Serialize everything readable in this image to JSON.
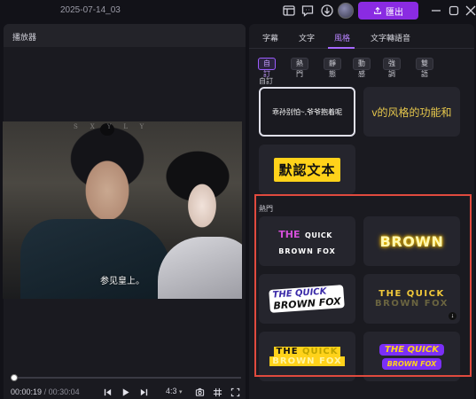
{
  "titlebar": {
    "project_name": "2025-07-14_03",
    "export_label": "匯出"
  },
  "player": {
    "header": "播放器",
    "watermark": "SXYLY",
    "subtitle": "参见皇上。",
    "current_time": "00:00:19",
    "total_time": "/ 00:30:04",
    "aspect_ratio": "4:3",
    "progress_fraction": 0.011
  },
  "sidebar": {
    "tabs": [
      {
        "label": "字幕"
      },
      {
        "label": "文字"
      },
      {
        "label": "風格",
        "active": true
      },
      {
        "label": "文字轉語音"
      }
    ],
    "filters": [
      {
        "label": "自訂",
        "active": true
      },
      {
        "label": "熱門"
      },
      {
        "label": "靜態"
      },
      {
        "label": "動感"
      },
      {
        "label": "強調"
      },
      {
        "label": "雙語"
      }
    ],
    "custom_section": {
      "label": "自訂",
      "cards": [
        {
          "text": "乖孙别怕~,爷爷抱着呢"
        },
        {
          "text": "v的风格的功能和"
        },
        {
          "text": "默認文本"
        }
      ]
    },
    "hot_section": {
      "label": "熱門",
      "styles": [
        {
          "line1a": "THE",
          "line1b": "QUICK",
          "line2": "BROWN FOX"
        },
        {
          "text": "BROWN"
        },
        {
          "line1": "THE QUICK",
          "line2": "BROWN FOX"
        },
        {
          "line1": "THE QUICK",
          "line2": "BROWN FOX"
        },
        {
          "line1a": "THE",
          "line1b": "QUICK",
          "line2": "BROWN FOX"
        },
        {
          "line1": "THE QUICK",
          "line2": "BROWN FOX"
        }
      ]
    }
  },
  "colors": {
    "accent": "#8a2be2",
    "tab_active": "#b884ff",
    "highlight_box": "#e04a3e"
  }
}
